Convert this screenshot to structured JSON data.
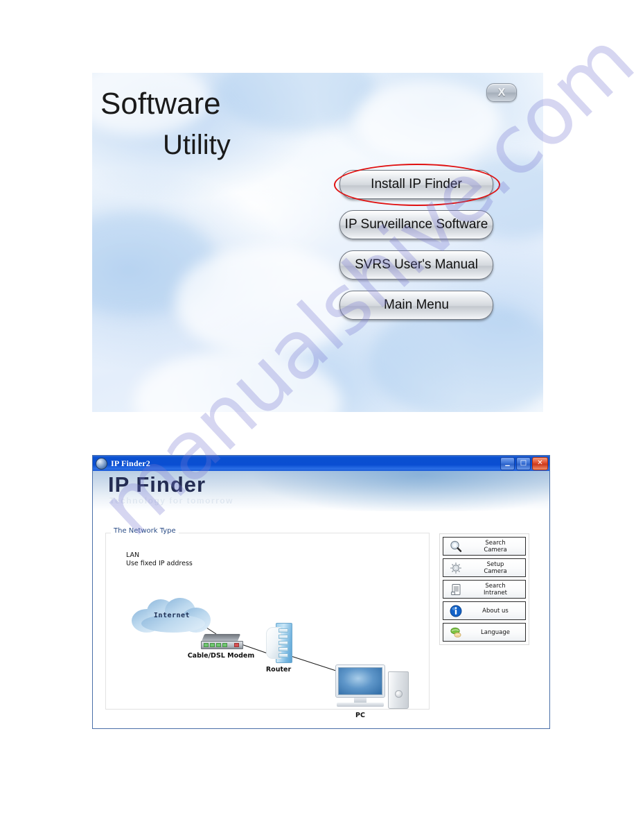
{
  "page": {
    "watermark": "manualshive.com"
  },
  "splash": {
    "title_line1": "Software",
    "title_line2": "Utility",
    "close_label": "X",
    "buttons": [
      {
        "label": "Install IP Finder",
        "highlighted": true
      },
      {
        "label": "IP Surveillance Software",
        "highlighted": false
      },
      {
        "label": "SVRS User's Manual",
        "highlighted": false
      },
      {
        "label": "Main Menu",
        "highlighted": false
      }
    ]
  },
  "ipfinder": {
    "window_title": "IP Finder2",
    "window_icon": "globe-icon",
    "titlebar_buttons": [
      {
        "name": "minimize-button",
        "glyph": "_"
      },
      {
        "name": "maximize-button",
        "glyph": "□"
      },
      {
        "name": "close-button",
        "glyph": "✕"
      }
    ],
    "banner": {
      "title": "IP Finder",
      "subtitle": "Technology for tomorrow"
    },
    "groupbox": {
      "legend": "The Network Type",
      "caption_line1": "LAN",
      "caption_line2": "Use fixed IP address"
    },
    "diagram": {
      "nodes": [
        {
          "id": "internet",
          "label": "Internet",
          "icon": "cloud-icon"
        },
        {
          "id": "modem",
          "label": "Cable/DSL\nModem",
          "icon": "modem-icon"
        },
        {
          "id": "router",
          "label": "Router",
          "icon": "router-icon"
        },
        {
          "id": "pc",
          "label": "PC",
          "icon": "computer-icon"
        }
      ],
      "connections": [
        {
          "from": "internet",
          "to": "modem"
        },
        {
          "from": "modem",
          "to": "router"
        },
        {
          "from": "router",
          "to": "pc"
        }
      ]
    },
    "side_buttons": [
      {
        "label": "Search\nCamera",
        "icon": "magnifier-icon"
      },
      {
        "label": "Setup\nCamera",
        "icon": "gear-icon"
      },
      {
        "label": "Search\nIntranet",
        "icon": "document-icon"
      },
      {
        "label": "About us",
        "icon": "info-icon"
      },
      {
        "label": "Language",
        "icon": "globe-leaf-icon"
      }
    ]
  },
  "colors": {
    "titlebar_blue": "#0a4ed2",
    "banner_text": "#232c52",
    "highlight_red": "#e01010",
    "watermark": "#7876d2"
  }
}
